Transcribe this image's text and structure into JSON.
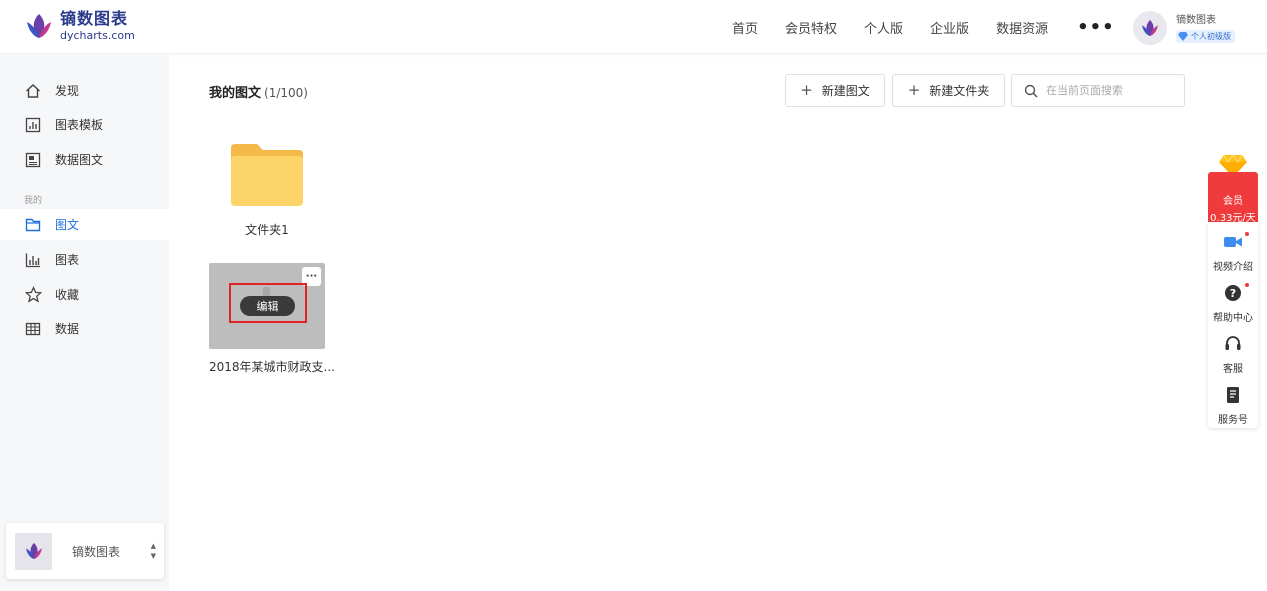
{
  "brand": {
    "name_cn": "镝数图表",
    "name_en": "dycharts.com"
  },
  "nav": {
    "items": [
      "首页",
      "会员特权",
      "个人版",
      "企业版",
      "数据资源"
    ],
    "more": "•••"
  },
  "user": {
    "name": "镝数图表",
    "badge": "个人初级版"
  },
  "sidebar": {
    "items": [
      {
        "label": "发现",
        "icon": "home-icon"
      },
      {
        "label": "图表模板",
        "icon": "chart-template-icon"
      },
      {
        "label": "数据图文",
        "icon": "data-article-icon"
      }
    ],
    "section_label": "我的",
    "my_items": [
      {
        "label": "图文",
        "icon": "article-icon",
        "active": true
      },
      {
        "label": "图表",
        "icon": "bar-chart-icon"
      },
      {
        "label": "收藏",
        "icon": "star-icon"
      },
      {
        "label": "数据",
        "icon": "table-icon"
      }
    ],
    "team": {
      "name": "镝数图表"
    }
  },
  "main": {
    "title": "我的图文",
    "count": "(1/100)",
    "new_article": "新建图文",
    "new_folder": "新建文件夹",
    "search_placeholder": "在当前页面搜索",
    "folder": {
      "name": "文件夹1"
    },
    "doc": {
      "edit_label": "编辑",
      "more": "···",
      "title": "2018年某城市财政支..."
    }
  },
  "float_bar": {
    "vip_line1": "会员",
    "vip_line2": "0.33元/天",
    "items": [
      {
        "label": "视频介绍",
        "icon": "video-camera-icon"
      },
      {
        "label": "帮助中心",
        "icon": "help-icon"
      },
      {
        "label": "客服",
        "icon": "headset-icon"
      },
      {
        "label": "服务号",
        "icon": "service-account-icon"
      }
    ]
  },
  "colors": {
    "accent": "#1f6fe0",
    "brand": "#2b3a8c",
    "vip": "#ef3b3b",
    "highlight": "#e02424"
  }
}
